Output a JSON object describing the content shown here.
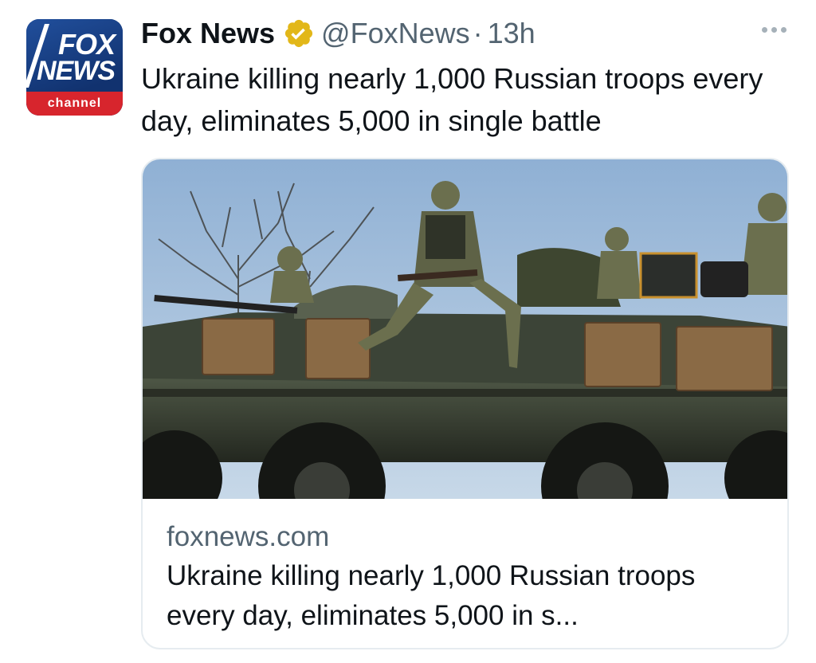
{
  "tweet": {
    "display_name": "Fox News",
    "handle": "@FoxNews",
    "separator": "·",
    "time": "13h",
    "text": "Ukraine killing nearly 1,000 Russian troops every day, eliminates 5,000 in single battle",
    "verified_icon": "verified-badge-gold",
    "more_icon": "more-horizontal-icon"
  },
  "avatar": {
    "line1": "FOX",
    "line2": "NEWS",
    "band": "channel",
    "colors": {
      "blue": "#1c3d79",
      "red": "#d7252d"
    }
  },
  "card": {
    "domain": "foxnews.com",
    "title": "Ukraine killing nearly 1,000 Russian troops every day, eliminates 5,000 in s...",
    "image_alt": "Soldiers riding on an armored personnel carrier"
  },
  "colors": {
    "text": "#0f1419",
    "secondary": "#536471",
    "border": "#e6ecf0",
    "verified_gold": "#e2b719"
  }
}
